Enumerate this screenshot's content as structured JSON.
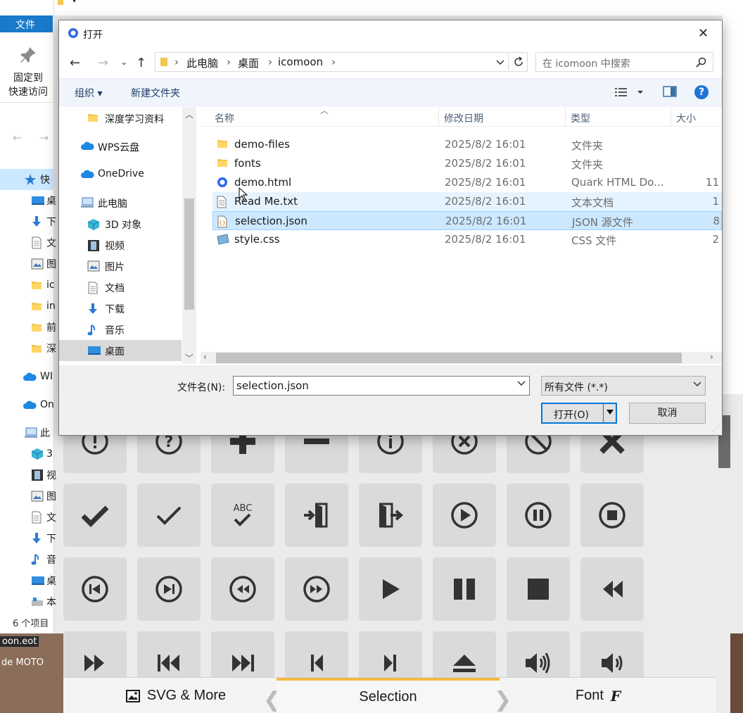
{
  "explorer": {
    "ribbon_tab": "文件",
    "pin_label_1": "固定到",
    "pin_label_2": "快速访问",
    "status": "6 个项目",
    "nav_items": [
      {
        "label": "快",
        "icon": "star-icon"
      },
      {
        "label": "桌",
        "icon": "desktop-icon"
      },
      {
        "label": "下",
        "icon": "download-icon"
      },
      {
        "label": "文",
        "icon": "document-icon"
      },
      {
        "label": "图",
        "icon": "picture-icon"
      },
      {
        "label": "ic",
        "icon": "folder-icon"
      },
      {
        "label": "in",
        "icon": "folder-icon"
      },
      {
        "label": "前",
        "icon": "folder-icon"
      },
      {
        "label": "深",
        "icon": "folder-icon"
      },
      {
        "label": "WI",
        "icon": "cloud-icon"
      },
      {
        "label": "On",
        "icon": "cloud-icon"
      },
      {
        "label": "此",
        "icon": "computer-icon"
      },
      {
        "label": "3",
        "icon": "cube-icon"
      },
      {
        "label": "视",
        "icon": "film-icon"
      },
      {
        "label": "图",
        "icon": "picture-icon"
      },
      {
        "label": "文",
        "icon": "document-icon"
      },
      {
        "label": "下",
        "icon": "download-icon"
      },
      {
        "label": "音",
        "icon": "music-icon"
      },
      {
        "label": "桌",
        "icon": "desktop-icon"
      },
      {
        "label": "本",
        "icon": "drive-icon"
      }
    ],
    "bg_file": "oon.eot",
    "bg_text": "de  MOTO"
  },
  "dialog": {
    "title": "打开",
    "address": [
      "此电脑",
      "桌面",
      "icomoon"
    ],
    "search_placeholder": "在 icomoon 中搜索",
    "organize": "组织 ▾",
    "new_folder": "新建文件夹",
    "help": "?",
    "tree": [
      {
        "label": "深度学习资料",
        "icon": "folder-icon",
        "indent": 2
      },
      {
        "label": "WPS云盘",
        "icon": "cloud-icon",
        "indent": 1
      },
      {
        "label": "OneDrive",
        "icon": "cloud-icon",
        "indent": 1
      },
      {
        "label": "此电脑",
        "icon": "computer-icon",
        "indent": 1
      },
      {
        "label": "3D 对象",
        "icon": "cube-icon",
        "indent": 2
      },
      {
        "label": "视频",
        "icon": "film-icon",
        "indent": 2
      },
      {
        "label": "图片",
        "icon": "picture-icon",
        "indent": 2
      },
      {
        "label": "文档",
        "icon": "document-icon",
        "indent": 2
      },
      {
        "label": "下载",
        "icon": "download-icon",
        "indent": 2
      },
      {
        "label": "音乐",
        "icon": "music-icon",
        "indent": 2
      },
      {
        "label": "桌面",
        "icon": "desktop-icon",
        "indent": 2,
        "selected": true
      }
    ],
    "columns": {
      "name": "名称",
      "date": "修改日期",
      "type": "类型",
      "size": "大小"
    },
    "files": [
      {
        "name": "demo-files",
        "date": "2025/8/2 16:01",
        "type": "文件夹",
        "size": "",
        "icon": "folder-icon"
      },
      {
        "name": "fonts",
        "date": "2025/8/2 16:01",
        "type": "文件夹",
        "size": "",
        "icon": "folder-icon"
      },
      {
        "name": "demo.html",
        "date": "2025/8/2 16:01",
        "type": "Quark HTML Do...",
        "size": "11",
        "icon": "quark-icon"
      },
      {
        "name": "Read Me.txt",
        "date": "2025/8/2 16:01",
        "type": "文本文档",
        "size": "1",
        "icon": "text-file-icon",
        "state": "hover"
      },
      {
        "name": "selection.json",
        "date": "2025/8/2 16:01",
        "type": "JSON 源文件",
        "size": "8",
        "icon": "json-file-icon",
        "state": "selected"
      },
      {
        "name": "style.css",
        "date": "2025/8/2 16:01",
        "type": "CSS 文件",
        "size": "2",
        "icon": "css-file-icon"
      }
    ],
    "filename_label": "文件名(N):",
    "filename_value": "selection.json",
    "filetype_value": "所有文件 (*.*)",
    "open_label": "打开(O)",
    "cancel_label": "取消"
  },
  "webapp": {
    "tiles": [
      [
        "notification-icon",
        "question-icon",
        "plus-icon",
        "minus-icon",
        "info-icon",
        "cancel-circle-icon",
        "blocked-icon",
        "cross-icon"
      ],
      [
        "checkmark-icon",
        "checkmark2-icon",
        "spell-check-icon",
        "enter-icon",
        "exit-icon",
        "play-icon",
        "pause-icon",
        "stop-icon"
      ],
      [
        "previous-icon",
        "next-icon",
        "backward-icon",
        "forward-icon",
        "play3-icon",
        "pause2-icon",
        "stop2-icon",
        "backward2-icon"
      ],
      [
        "forward3-icon",
        "first-icon",
        "last-icon",
        "previous2-icon",
        "next2-icon",
        "eject-icon",
        "volume-high-icon",
        "volume-medium-icon"
      ]
    ],
    "tabs": {
      "svg": "SVG & More",
      "selection": "Selection",
      "font": "Font"
    }
  }
}
